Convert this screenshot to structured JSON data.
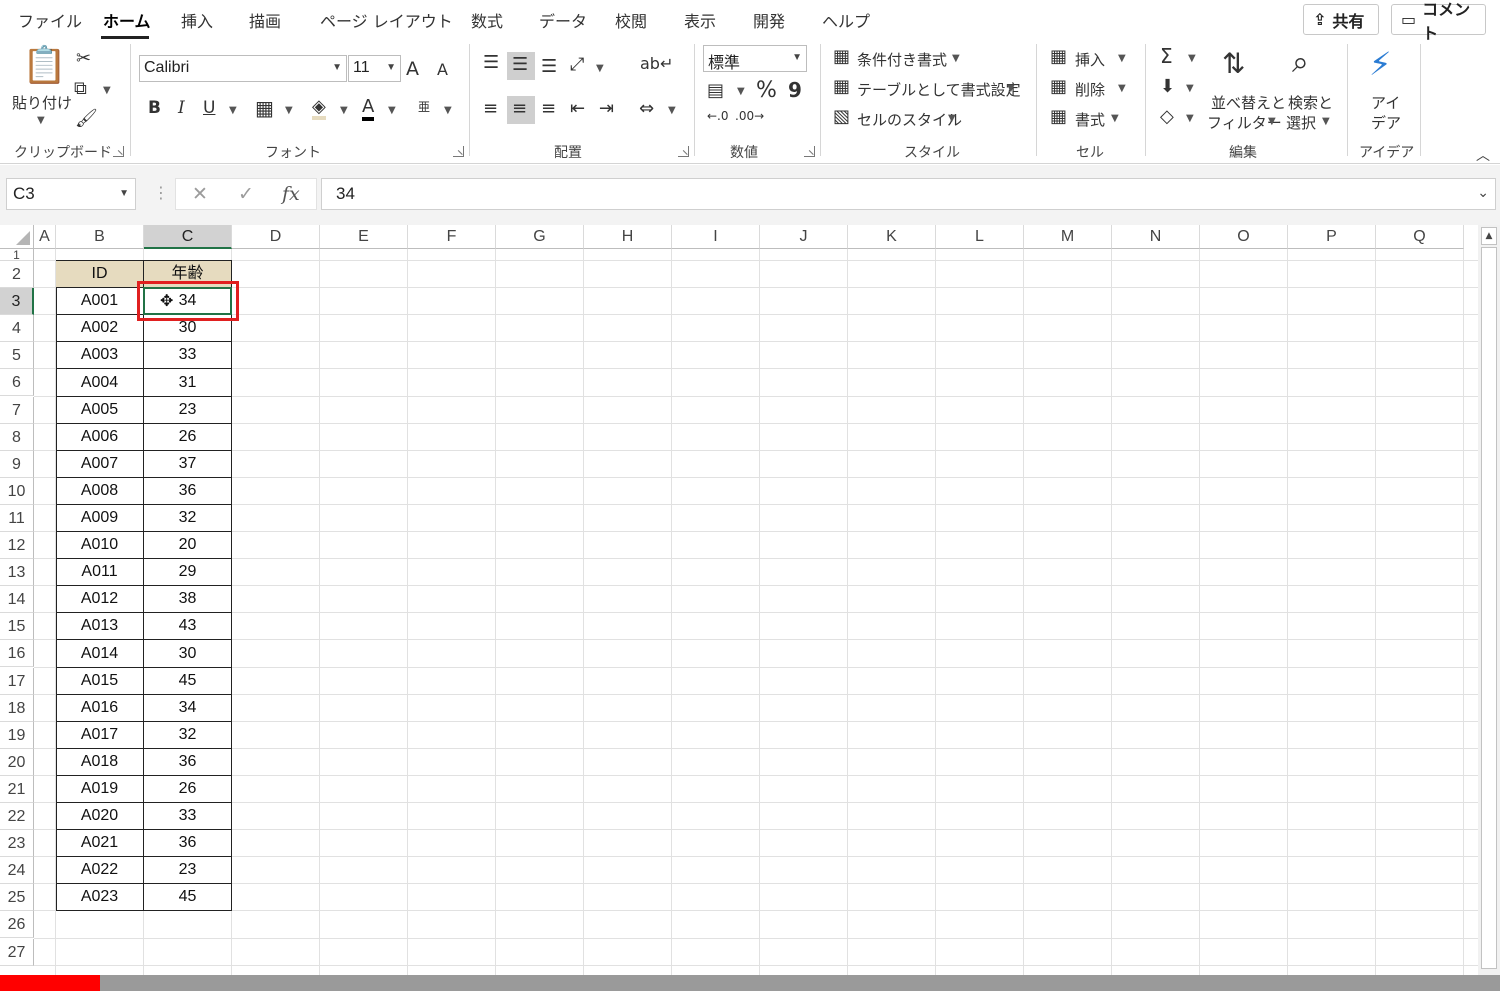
{
  "tabs": [
    "ファイル",
    "ホーム",
    "挿入",
    "描画",
    "ページ レイアウト",
    "数式",
    "データ",
    "校閲",
    "表示",
    "開発",
    "ヘルプ"
  ],
  "share_label": "共有",
  "comment_label": "コメント",
  "clipboard": {
    "paste_label": "貼り付け",
    "group_label": "クリップボード"
  },
  "font": {
    "name": "Calibri",
    "size": "11",
    "group_label": "フォント",
    "grow_label": "A",
    "shrink_label": "A",
    "bold_label": "B",
    "italic_label": "I",
    "underline_label": "U",
    "color_label": "A",
    "phonetic_label": "亜"
  },
  "alignment": {
    "group_label": "配置"
  },
  "number": {
    "format": "標準",
    "percent_label": "%",
    "comma_label": "9",
    "group_label": "数値"
  },
  "styles": {
    "conditional_label": "条件付き書式",
    "table_label": "テーブルとして書式設定",
    "cell_styles_label": "セルのスタイル",
    "group_label": "スタイル"
  },
  "cells": {
    "insert_label": "挿入",
    "delete_label": "削除",
    "format_label": "書式",
    "group_label": "セル"
  },
  "editing": {
    "sort_label_1": "並べ替えと",
    "sort_label_2": "フィルター",
    "find_label_1": "検索と",
    "find_label_2": "選択",
    "group_label": "編集"
  },
  "ideas": {
    "label_1": "アイ",
    "label_2": "デア",
    "group_label": "アイデア"
  },
  "formula_bar": {
    "name_box": "C3",
    "value": "34",
    "fx_label": "fx"
  },
  "columns": [
    "A",
    "B",
    "C",
    "D",
    "E",
    "F",
    "G",
    "H",
    "I",
    "J",
    "K",
    "L",
    "M",
    "N",
    "O",
    "P",
    "Q"
  ],
  "rows": [
    "1",
    "2",
    "3",
    "4",
    "5",
    "6",
    "7",
    "8",
    "9",
    "10",
    "11",
    "12",
    "13",
    "14",
    "15",
    "16",
    "17",
    "18",
    "19",
    "20",
    "21",
    "22",
    "23",
    "24",
    "25",
    "26",
    "27"
  ],
  "table": {
    "headers": [
      "ID",
      "年齢"
    ],
    "rows": [
      [
        "A001",
        "34"
      ],
      [
        "A002",
        "30"
      ],
      [
        "A003",
        "33"
      ],
      [
        "A004",
        "31"
      ],
      [
        "A005",
        "23"
      ],
      [
        "A006",
        "26"
      ],
      [
        "A007",
        "37"
      ],
      [
        "A008",
        "36"
      ],
      [
        "A009",
        "32"
      ],
      [
        "A010",
        "20"
      ],
      [
        "A011",
        "29"
      ],
      [
        "A012",
        "38"
      ],
      [
        "A013",
        "43"
      ],
      [
        "A014",
        "30"
      ],
      [
        "A015",
        "45"
      ],
      [
        "A016",
        "34"
      ],
      [
        "A017",
        "32"
      ],
      [
        "A018",
        "36"
      ],
      [
        "A019",
        "26"
      ],
      [
        "A020",
        "33"
      ],
      [
        "A021",
        "36"
      ],
      [
        "A022",
        "23"
      ],
      [
        "A023",
        "45"
      ]
    ]
  },
  "colors": {
    "accent": "#217346",
    "table_header_fill": "#e6dbbf",
    "highlight": "#e02020"
  }
}
